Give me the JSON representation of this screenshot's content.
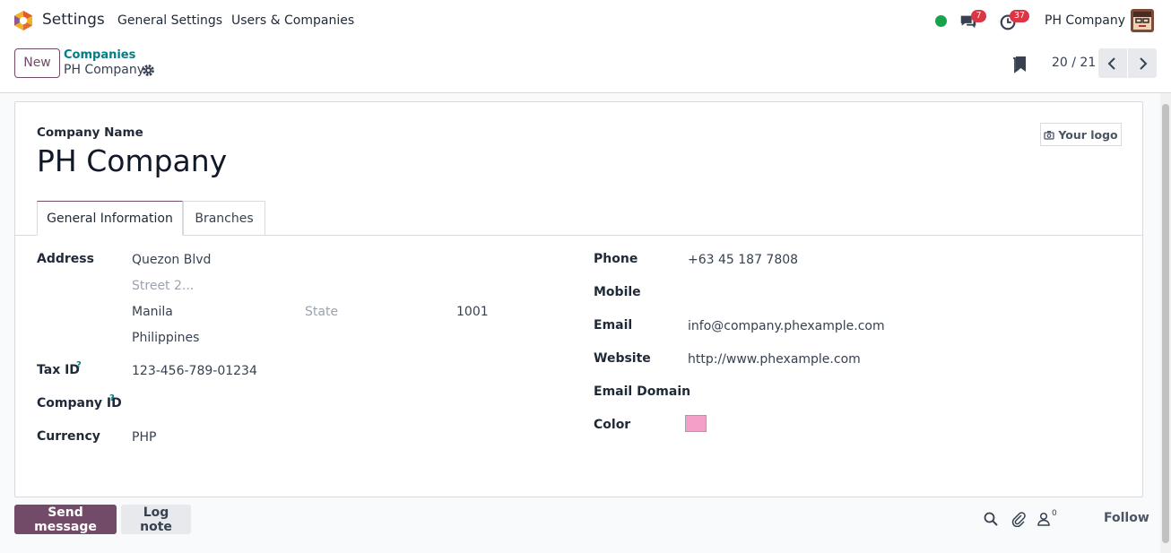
{
  "navbar": {
    "app_name": "Settings",
    "menu": [
      "General Settings",
      "Users & Companies"
    ],
    "messages_count": "7",
    "activities_count": "37",
    "company": "PH Company"
  },
  "control_panel": {
    "new_label": "New",
    "breadcrumb_parent": "Companies",
    "breadcrumb_current": "PH Company",
    "pager": "20 / 21"
  },
  "form": {
    "company_name_label": "Company Name",
    "company_name": "PH Company",
    "logo_button": "Your logo",
    "tabs": [
      "General Information",
      "Branches"
    ],
    "left": {
      "address_label": "Address",
      "street": "Quezon Blvd",
      "street2_placeholder": "Street 2...",
      "city": "Manila",
      "state_placeholder": "State",
      "zip": "1001",
      "country": "Philippines",
      "tax_id_label": "Tax ID",
      "tax_id": "123-456-789-01234",
      "company_id_label": "Company ID",
      "currency_label": "Currency",
      "currency": "PHP",
      "help_mark": "?"
    },
    "right": {
      "phone_label": "Phone",
      "phone": "+63 45 187 7808",
      "mobile_label": "Mobile",
      "email_label": "Email",
      "email": "info@company.phexample.com",
      "website_label": "Website",
      "website": "http://www.phexample.com",
      "email_domain_label": "Email Domain",
      "color_label": "Color",
      "color_value": "#f49fc8"
    }
  },
  "chatter": {
    "send_message": "Send message",
    "log_note": "Log note",
    "followers_count": "0",
    "follow": "Follow"
  },
  "colors": {
    "brand": "#714b67",
    "link": "#017e84",
    "badge": "#dc3545",
    "online": "#16a34a"
  }
}
